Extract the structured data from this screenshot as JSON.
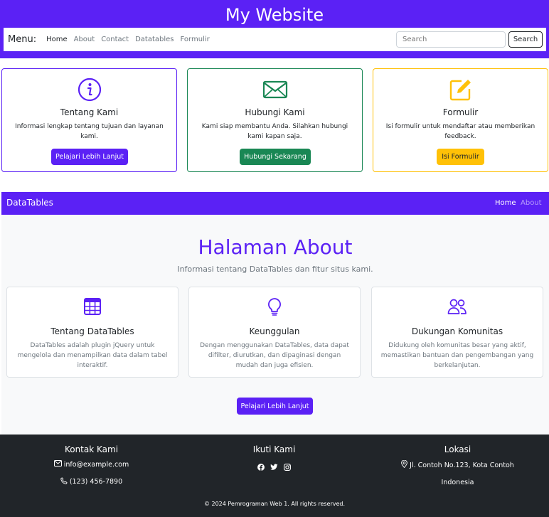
{
  "header": {
    "title": "My Website"
  },
  "menu": {
    "label": "Menu:",
    "links": [
      "Home",
      "About",
      "Contact",
      "Datatables",
      "Formulir"
    ],
    "search_placeholder": "Search",
    "search_button": "Search"
  },
  "cards": [
    {
      "icon": "info-circle-icon",
      "title": "Tentang Kami",
      "text": "Informasi lengkap tentang tujuan dan layanan kami.",
      "button": "Pelajari Lebih Lanjut",
      "color": "#5b21f5"
    },
    {
      "icon": "envelope-icon",
      "title": "Hubungi Kami",
      "text": "Kami siap membantu Anda. Silahkan hubungi kami kapan saja.",
      "button": "Hubungi Sekarang",
      "color": "#198754"
    },
    {
      "icon": "pencil-square-icon",
      "title": "Formulir",
      "text": "Isi formulir untuk mendaftar atau memberikan feedback.",
      "button": "Isi Formulir",
      "color": "#ffc107"
    }
  ],
  "datatables_nav": {
    "brand": "DataTables",
    "links": [
      "Home",
      "About"
    ]
  },
  "about": {
    "title": "Halaman About",
    "subtitle": "Informasi tentang DataTables dan fitur situs kami.",
    "features": [
      {
        "icon": "table-icon",
        "title": "Tentang DataTables",
        "text": "DataTables adalah plugin jQuery untuk mengelola dan menampilkan data dalam tabel interaktif."
      },
      {
        "icon": "lightbulb-icon",
        "title": "Keunggulan",
        "text": "Dengan menggunakan DataTables, data dapat difilter, diurutkan, dan dipaginasi dengan mudah dan juga efisien."
      },
      {
        "icon": "people-icon",
        "title": "Dukungan Komunitas",
        "text": "Didukung oleh komunitas besar yang aktif, memastikan bantuan dan pengembangan yang berkelanjutan."
      }
    ],
    "button": "Pelajari Lebih Lanjut"
  },
  "footer": {
    "contact_title": "Kontak Kami",
    "email": "info@example.com",
    "phone": "(123) 456-7890",
    "follow_title": "Ikuti Kami",
    "socials": [
      "facebook-icon",
      "twitter-icon",
      "instagram-icon"
    ],
    "location_title": "Lokasi",
    "address_line1": "Jl. Contoh No.123, Kota Contoh",
    "address_line2": "Indonesia",
    "copyright": "© 2024 Pemrograman Web 1. All rights reserved."
  },
  "colors": {
    "primary": "#5b21f5",
    "success": "#198754",
    "warning": "#ffc107",
    "dark": "#212529"
  }
}
